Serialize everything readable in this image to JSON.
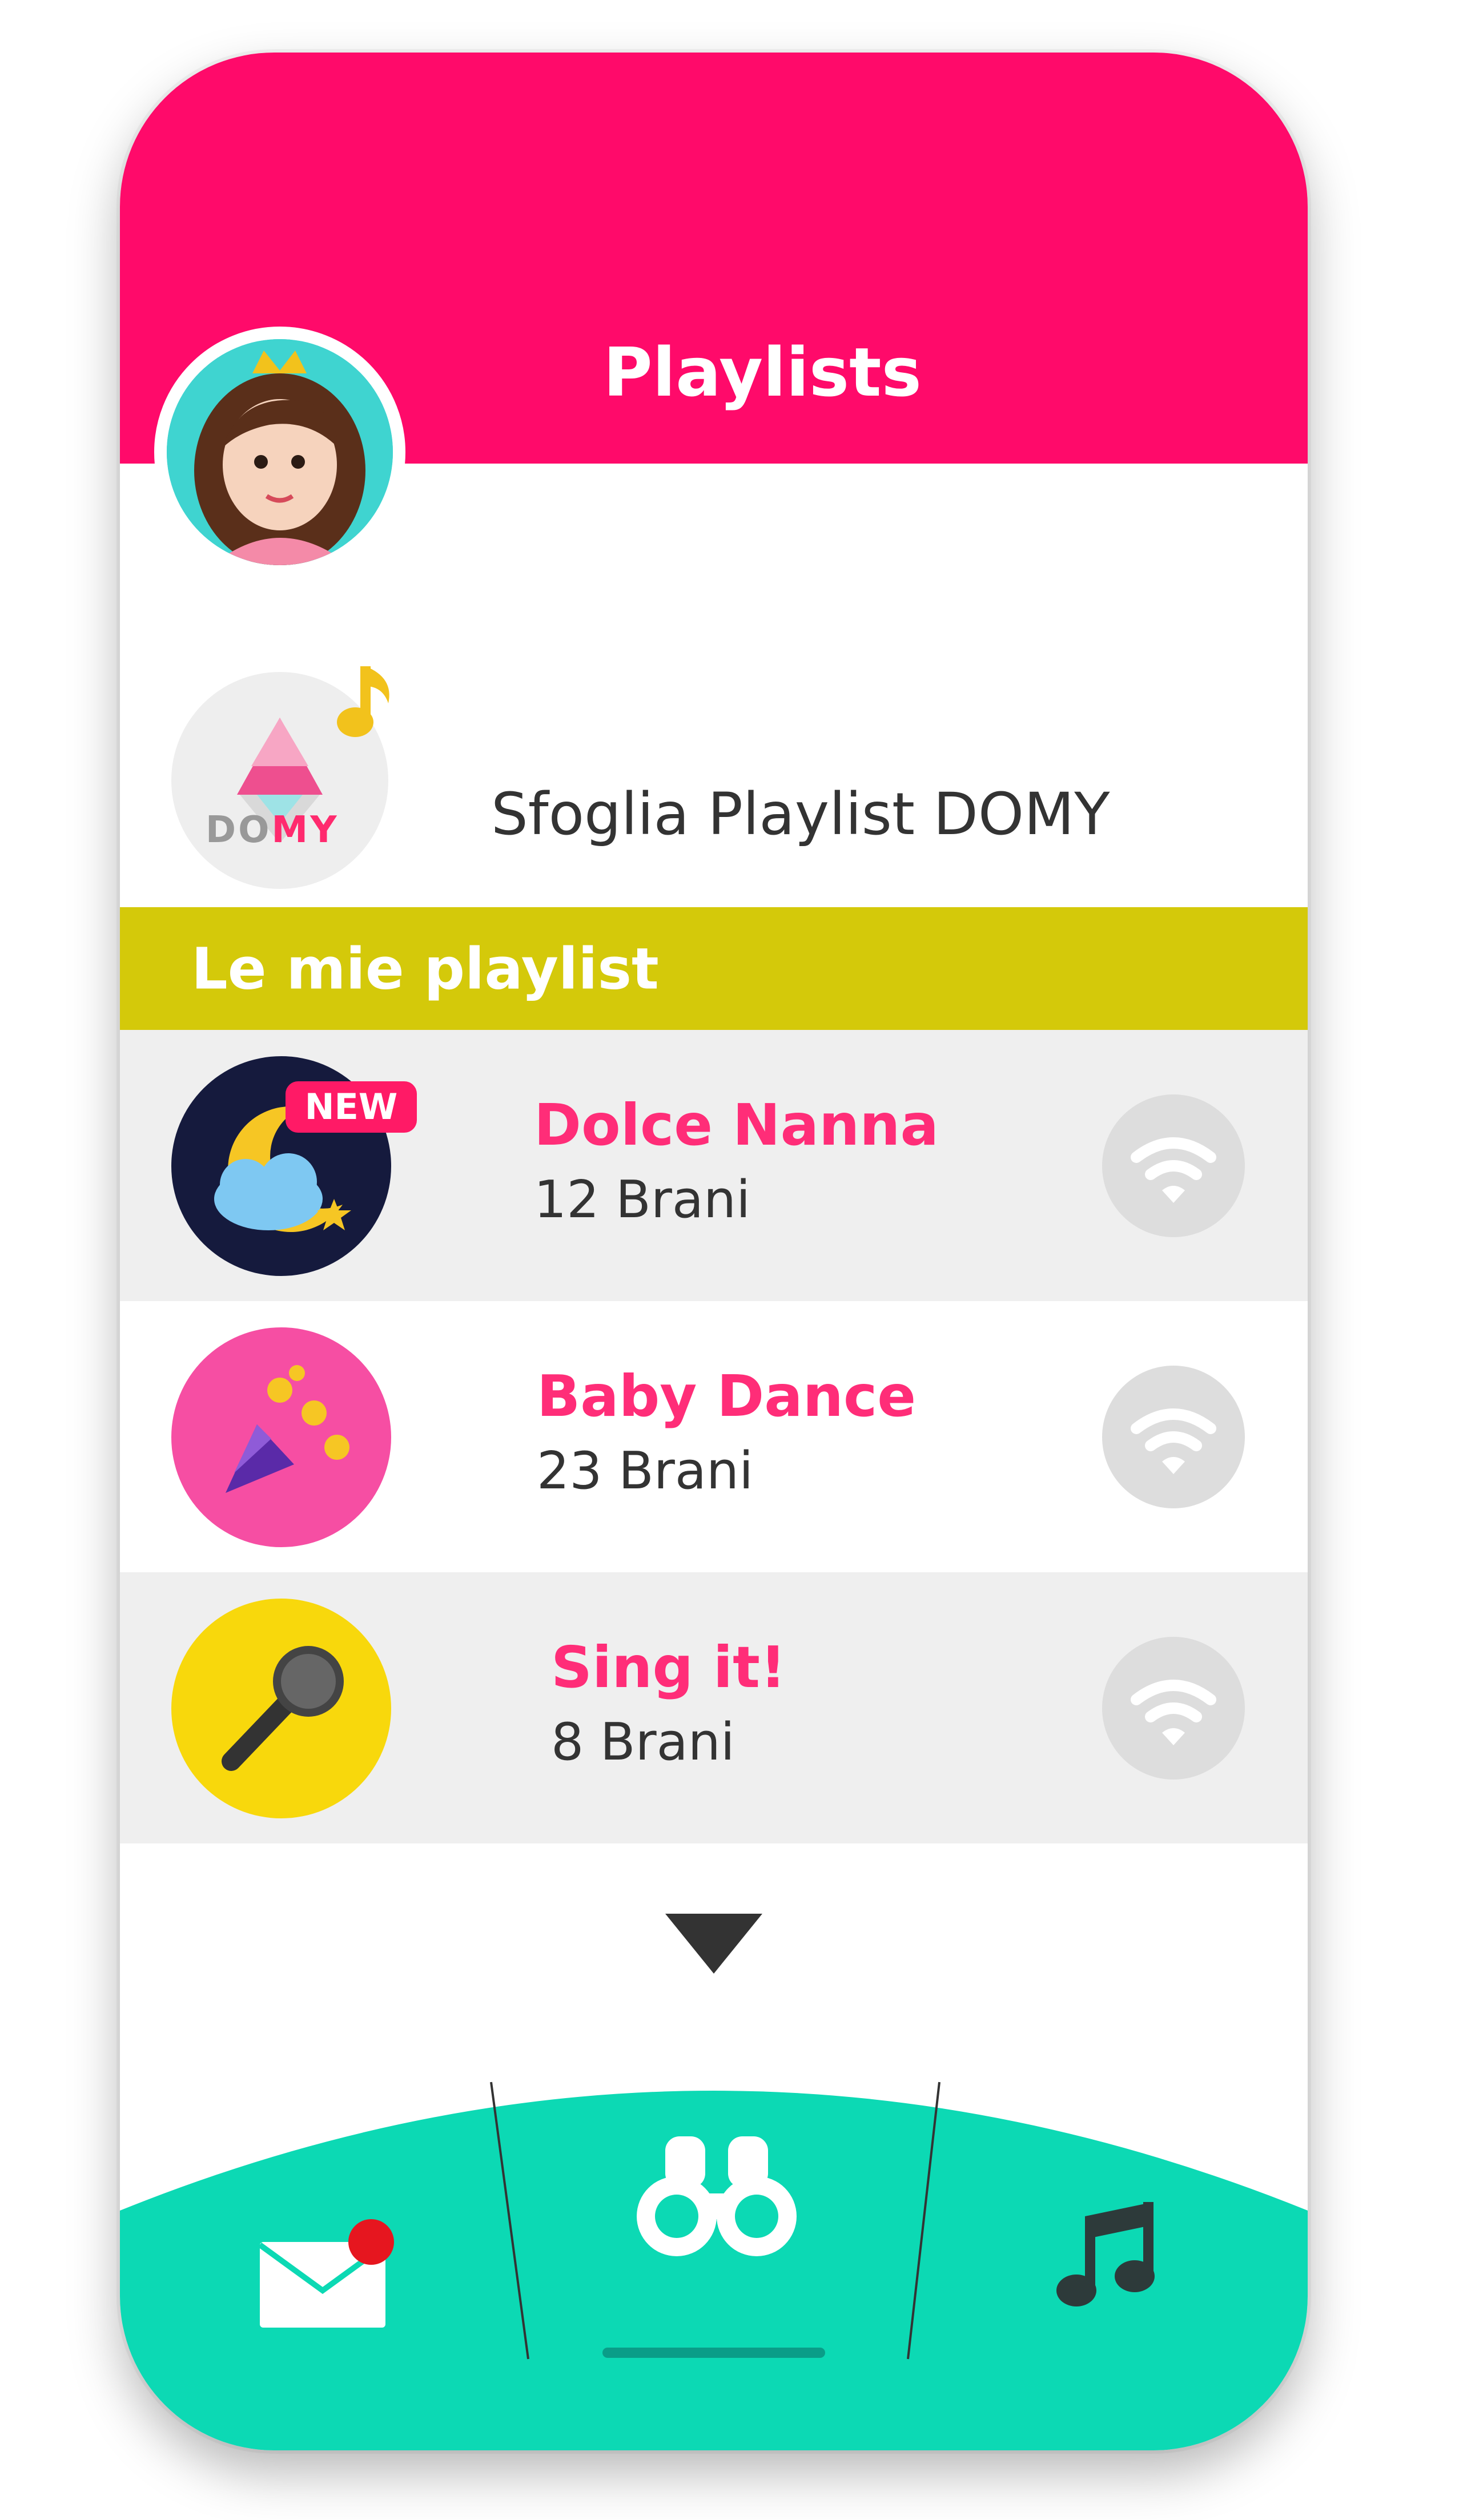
{
  "header": {
    "title": "Playlists"
  },
  "browse": {
    "logo_text_a": "DO",
    "logo_text_b": "MY",
    "label": "Sfoglia Playlist DOMY"
  },
  "section": {
    "title": "Le mie playlist"
  },
  "playlists": [
    {
      "name": "Dolce Nanna",
      "count": "12 Brani",
      "badge": "NEW",
      "icon": "moon-cloud-icon"
    },
    {
      "name": "Baby Dance",
      "count": "23 Brani",
      "icon": "party-popper-icon"
    },
    {
      "name": "Sing it!",
      "count": "8 Brani",
      "icon": "microphone-icon"
    }
  ],
  "nav": {
    "items": [
      {
        "icon": "mail-icon",
        "has_notification": true
      },
      {
        "icon": "binoculars-icon"
      },
      {
        "icon": "music-note-icon"
      }
    ]
  },
  "colors": {
    "header": "#ff0a6a",
    "section": "#d4c90a",
    "nav": "#0cd9b4",
    "title_pink": "#ff2d78"
  }
}
